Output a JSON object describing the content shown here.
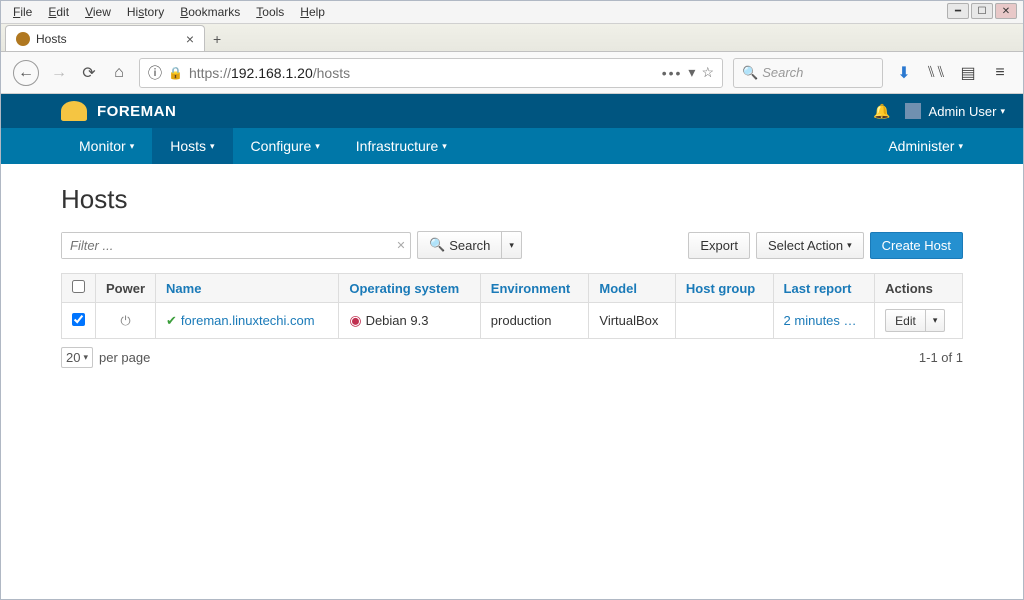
{
  "menubar": {
    "items": [
      "File",
      "Edit",
      "View",
      "History",
      "Bookmarks",
      "Tools",
      "Help"
    ]
  },
  "tab": {
    "title": "Hosts"
  },
  "browser": {
    "url_prefix": "https://",
    "url_host": "192.168.1.20",
    "url_path": "/hosts",
    "search_placeholder": "Search"
  },
  "header": {
    "brand": "FOREMAN",
    "user": "Admin User"
  },
  "nav": {
    "items": [
      "Monitor",
      "Hosts",
      "Configure",
      "Infrastructure"
    ],
    "active_index": 1,
    "right": "Administer"
  },
  "page": {
    "title": "Hosts",
    "filter_placeholder": "Filter ...",
    "search_btn": "Search",
    "export_btn": "Export",
    "select_action_btn": "Select Action",
    "create_btn": "Create Host",
    "columns": [
      "",
      "Power",
      "Name",
      "Operating system",
      "Environment",
      "Model",
      "Host group",
      "Last report",
      "Actions"
    ],
    "rows": [
      {
        "checked": true,
        "name": "foreman.linuxtechi.com",
        "os": "Debian 9.3",
        "environment": "production",
        "model": "VirtualBox",
        "host_group": "",
        "last_report": "2 minutes …",
        "edit": "Edit"
      }
    ],
    "per_page": "20",
    "per_page_label": "per page",
    "count": "1-1 of 1"
  }
}
